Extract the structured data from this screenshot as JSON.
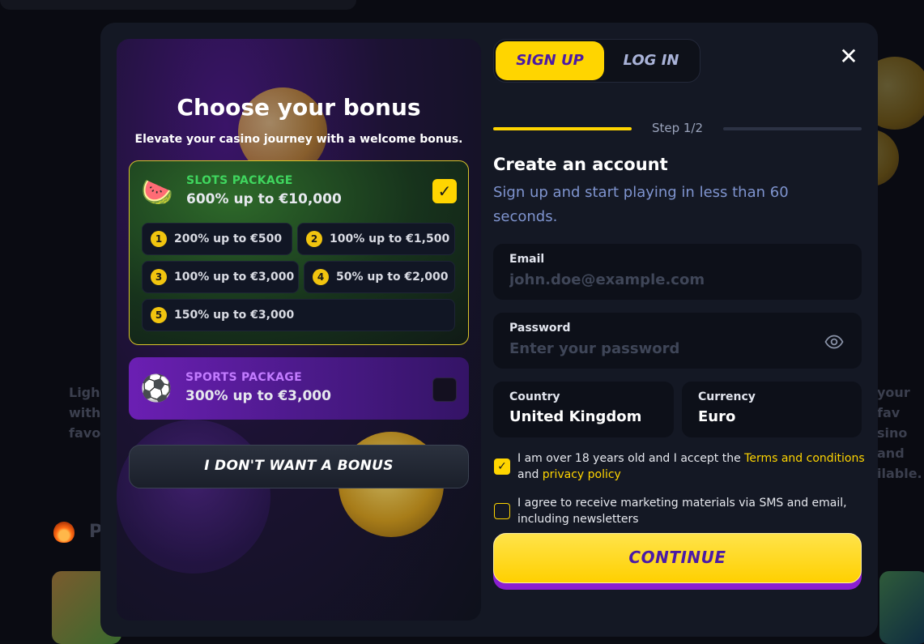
{
  "background": {
    "left_text": [
      "Ligh",
      "with",
      "favo"
    ],
    "right_text": [
      "your fav",
      "sino and",
      "ilable."
    ],
    "section_initial": "P"
  },
  "bonus_panel": {
    "title": "Choose your bonus",
    "subtitle": "Elevate your casino journey with a welcome bonus.",
    "slots": {
      "icon": "watermelon-icon",
      "label": "SLOTS PACKAGE",
      "value": "600% up to €10,000",
      "checked": true,
      "tiers": [
        {
          "num": "1",
          "text": "200% up to €500"
        },
        {
          "num": "2",
          "text": "100% up to €1,500"
        },
        {
          "num": "3",
          "text": "100% up to €3,000"
        },
        {
          "num": "4",
          "text": "50% up to €2,000"
        },
        {
          "num": "5",
          "text": "150% up to €3,000"
        }
      ]
    },
    "sports": {
      "icon": "soccer-ball-icon",
      "label": "SPORTS PACKAGE",
      "value": "300% up to €3,000",
      "checked": false
    },
    "no_bonus_label": "I DON'T WANT A BONUS"
  },
  "auth": {
    "tabs": {
      "signup": "SIGN UP",
      "login": "LOG IN",
      "active": "signup"
    },
    "step_label": "Step 1/2",
    "progress": 0.5,
    "title": "Create an account",
    "subtitle": "Sign up and start playing in less than 60 seconds.",
    "email": {
      "label": "Email",
      "placeholder": "john.doe@example.com",
      "value": ""
    },
    "password": {
      "label": "Password",
      "placeholder": "Enter your password",
      "value": ""
    },
    "country": {
      "label": "Country",
      "value": "United Kingdom"
    },
    "currency": {
      "label": "Currency",
      "value": "Euro"
    },
    "terms": {
      "checked": true,
      "text_before": "I am over 18 years old and I accept the ",
      "terms_link": "Terms and conditions",
      "text_mid": "and ",
      "privacy_link": "privacy policy"
    },
    "marketing": {
      "checked": false,
      "text": "I agree to receive marketing materials via SMS and email, including newsletters"
    },
    "continue_label": "CONTINUE"
  },
  "colors": {
    "accent": "#ffd500",
    "purple": "#4b1aa6",
    "slots_green": "#3fd65e",
    "sports_purple": "#c27bff",
    "modal_bg": "#141824"
  }
}
